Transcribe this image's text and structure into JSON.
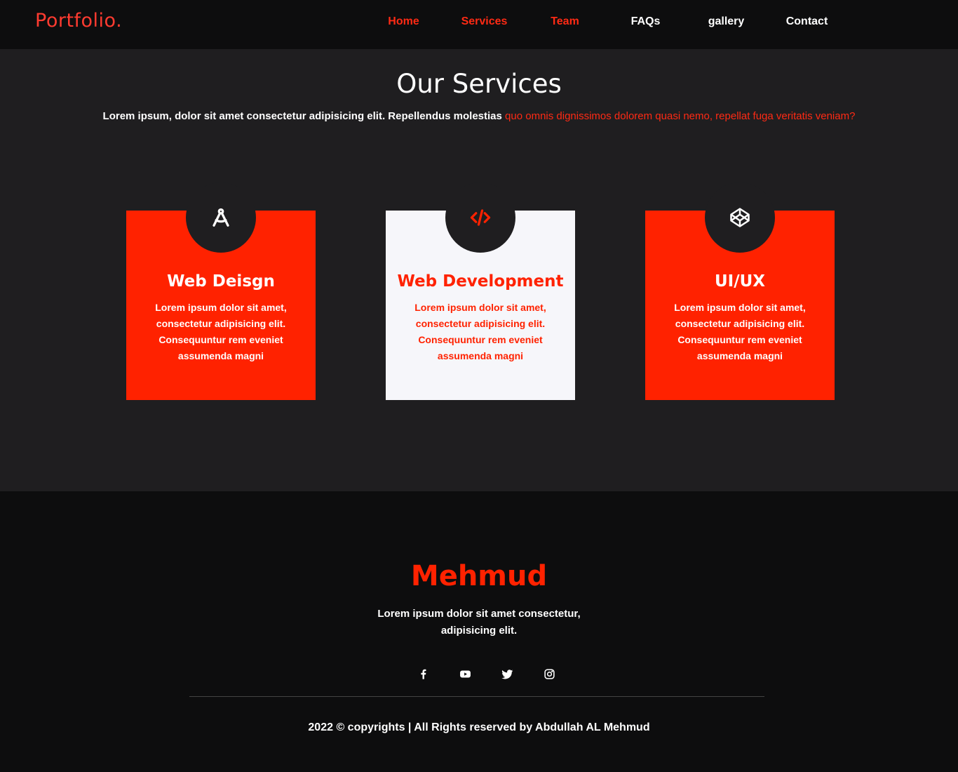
{
  "nav": {
    "logo_text": "Portfolio",
    "logo_dot": ".",
    "links": [
      {
        "label": "Home"
      },
      {
        "label": "Services"
      },
      {
        "label": "Team"
      },
      {
        "label": "FAQs"
      },
      {
        "label": "gallery"
      },
      {
        "label": "Contact"
      }
    ],
    "colors": {
      "accent": "#ff2a14",
      "inactive": "#ffffff"
    }
  },
  "services": {
    "title": "Our Services",
    "desc_plain": "Lorem ipsum, dolor sit amet consectetur adipisicing elit. Repellendus molestias ",
    "desc_highlight": "quo omnis dignissimos dolorem quasi nemo, repellat fuga veritatis veniam?",
    "cards": [
      {
        "icon": "compass-icon",
        "title": "Web Deisgn",
        "text": "Lorem ipsum dolor sit amet, consectetur adipisicing elit. Consequuntur rem eveniet assumenda magni",
        "bg": "#ff2200"
      },
      {
        "icon": "code-icon",
        "title": "Web Development",
        "text": "Lorem ipsum dolor sit amet, consectetur adipisicing elit. Consequuntur rem eveniet assumenda magni",
        "bg": "#f6f6fa"
      },
      {
        "icon": "codepen-icon",
        "title": "UI/UX",
        "text": "Lorem ipsum dolor sit amet, consectetur adipisicing elit. Consequuntur rem eveniet assumenda magni",
        "bg": "#ff2200"
      }
    ]
  },
  "footer": {
    "name": "Mehmud",
    "desc": "Lorem ipsum dolor sit amet consectetur, adipisicing elit.",
    "social": [
      "facebook-icon",
      "youtube-icon",
      "twitter-icon",
      "instagram-icon"
    ],
    "copyright": "2022 © copyrights | All Rights reserved by Abdullah AL Mehmud"
  },
  "colors": {
    "page_bg": "#1f1e20",
    "footer_bg": "#0d0d0e",
    "accent": "#ff2200"
  }
}
